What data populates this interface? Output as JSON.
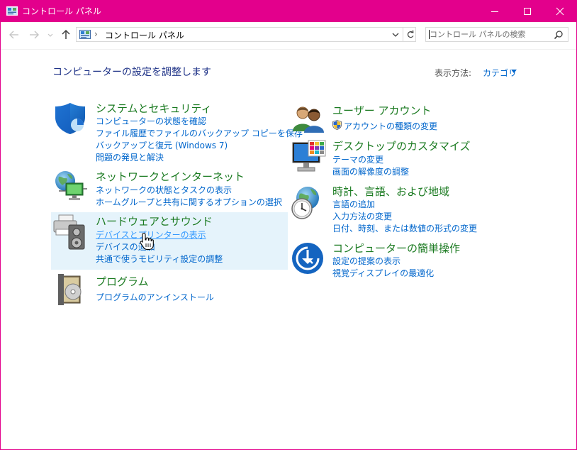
{
  "window": {
    "title": "コントロール パネル",
    "accent_color": "#e3008c"
  },
  "nav": {
    "back_icon": "arrow-left-icon",
    "forward_icon": "arrow-right-icon",
    "recent_icon": "chevron-down-icon",
    "up_icon": "arrow-up-icon",
    "breadcrumb_separator": "›",
    "breadcrumb": "コントロール パネル",
    "search_placeholder": "コントロール パネルの検索"
  },
  "header": {
    "title": "コンピューターの設定を調整します",
    "view_by_label": "表示方法:",
    "view_by_value": "カテゴリ"
  },
  "left_categories": [
    {
      "icon": "shield-icon",
      "title": "システムとセキュリティ",
      "links": [
        "コンピューターの状態を確認",
        "ファイル履歴でファイルのバックアップ コピーを保存",
        "バックアップと復元 (Windows 7)",
        "問題の発見と解決"
      ]
    },
    {
      "icon": "network-globe-icon",
      "title": "ネットワークとインターネット",
      "links": [
        "ネットワークの状態とタスクの表示",
        "ホームグループと共有に関するオプションの選択"
      ]
    },
    {
      "icon": "printer-speaker-icon",
      "title": "ハードウェアとサウンド",
      "links": [
        "デバイスとプリンターの表示",
        "デバイスの追加",
        "共通で使うモビリティ設定の調整"
      ]
    },
    {
      "icon": "programs-disc-icon",
      "title": "プログラム",
      "links": [
        "プログラムのアンインストール"
      ]
    }
  ],
  "right_categories": [
    {
      "icon": "users-icon",
      "title": "ユーザー アカウント",
      "links": [
        "アカウントの種類の変更"
      ]
    },
    {
      "icon": "monitor-palette-icon",
      "title": "デスクトップのカスタマイズ",
      "links": [
        "テーマの変更",
        "画面の解像度の調整"
      ]
    },
    {
      "icon": "clock-globe-icon",
      "title": "時計、言語、および地域",
      "links": [
        "言語の追加",
        "入力方法の変更",
        "日付、時刻、または数値の形式の変更"
      ]
    },
    {
      "icon": "ease-of-access-icon",
      "title": "コンピューターの簡単操作",
      "links": [
        "設定の提案の表示",
        "視覚ディスプレイの最適化"
      ]
    }
  ]
}
